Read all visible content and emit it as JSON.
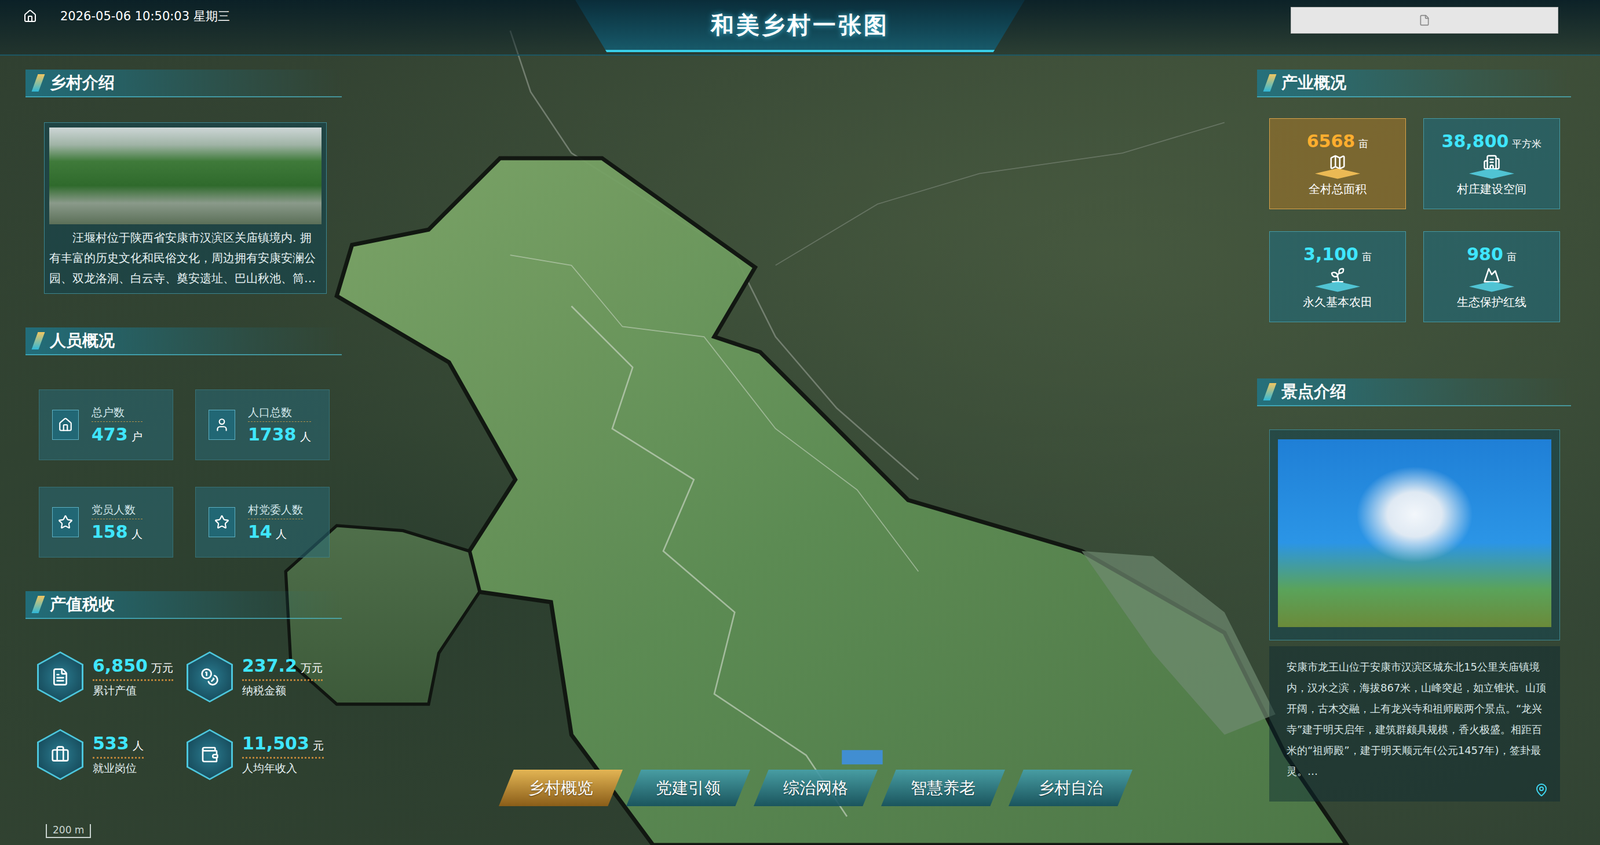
{
  "header": {
    "datetime": "2026-05-06 10:50:03 星期三",
    "title": "和美乡村一张图"
  },
  "intro": {
    "title": "乡村介绍",
    "text": "汪堰村位于陕西省安康市汉滨区关庙镇境内. 拥有丰富的历史文化和民俗文化，周边拥有安康安澜公园、双龙洛洞、白云寺、奠安遗址、巴山秋池、筒…"
  },
  "people": {
    "title": "人员概况",
    "items": [
      {
        "label": "总户数",
        "value": "473",
        "unit": "户"
      },
      {
        "label": "人口总数",
        "value": "1738",
        "unit": "人"
      },
      {
        "label": "党员人数",
        "value": "158",
        "unit": "人"
      },
      {
        "label": "村党委人数",
        "value": "14",
        "unit": "人"
      }
    ]
  },
  "output": {
    "title": "产值税收",
    "items": [
      {
        "label": "累计产值",
        "value": "6,850",
        "unit": "万元"
      },
      {
        "label": "纳税金额",
        "value": "237.2",
        "unit": "万元"
      },
      {
        "label": "就业岗位",
        "value": "533",
        "unit": "人"
      },
      {
        "label": "人均年收入",
        "value": "11,503",
        "unit": "元"
      }
    ]
  },
  "industry": {
    "title": "产业概况",
    "items": [
      {
        "label": "全村总面积",
        "value": "6568",
        "unit": "亩",
        "selected": true
      },
      {
        "label": "村庄建设空间",
        "value": "38,800",
        "unit": "平方米",
        "selected": false
      },
      {
        "label": "永久基本农田",
        "value": "3,100",
        "unit": "亩",
        "selected": false
      },
      {
        "label": "生态保护红线",
        "value": "980",
        "unit": "亩",
        "selected": false
      }
    ]
  },
  "spot": {
    "title": "景点介绍",
    "text": "安康市龙王山位于安康市汉滨区城东北15公里关庙镇境内，汉水之滨，海拔867米，山峰突起，如立锥状。山顶开阔，古木交融，上有龙兴寺和祖师殿两个景点。“龙兴寺”建于明天启年，建筑群颇具规模，香火极盛。相距百米的“祖师殿”，建于明天顺元年(公元1457年)，签卦最灵。…"
  },
  "tabs": [
    {
      "label": "乡村概览",
      "selected": true
    },
    {
      "label": "党建引领",
      "selected": false
    },
    {
      "label": "综治网格",
      "selected": false
    },
    {
      "label": "智慧养老",
      "selected": false
    },
    {
      "label": "乡村自治",
      "selected": false
    }
  ],
  "map": {
    "scale": "200 m"
  }
}
